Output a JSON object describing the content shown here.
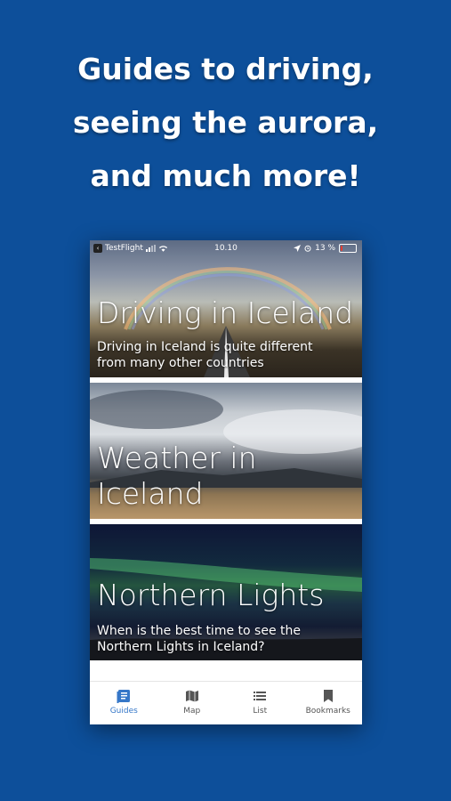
{
  "headline": {
    "line1": "Guides to driving,",
    "line2": "seeing the aurora,",
    "line3": "and much more!"
  },
  "status_bar": {
    "app": "TestFlight",
    "time": "10.10",
    "battery": "13 %",
    "battery_level": 0.13
  },
  "cards": [
    {
      "title_line1": "Driving in Iceland",
      "title_line2": "",
      "subtitle_line1": "Driving in Iceland is quite different",
      "subtitle_line2": "from many other countries"
    },
    {
      "title_line1": "Weather in",
      "title_line2": "Iceland",
      "subtitle_line1": "",
      "subtitle_line2": ""
    },
    {
      "title_line1": "Northern Lights",
      "title_line2": "",
      "subtitle_line1": "When is the best time to see the",
      "subtitle_line2": "Northern Lights in Iceland?"
    }
  ],
  "tabs": [
    {
      "label": "Guides",
      "icon": "guides-icon",
      "active": true
    },
    {
      "label": "Map",
      "icon": "map-icon",
      "active": false
    },
    {
      "label": "List",
      "icon": "list-icon",
      "active": false
    },
    {
      "label": "Bookmarks",
      "icon": "bookmark-icon",
      "active": false
    }
  ],
  "colors": {
    "background": "#0d4f9a",
    "accent": "#3577c8"
  }
}
